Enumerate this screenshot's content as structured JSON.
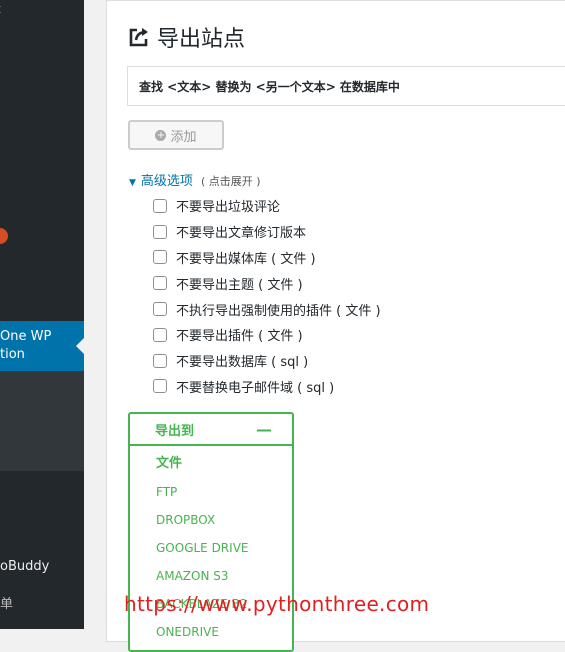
{
  "sidebar": {
    "top_fragment": "t",
    "badge": "",
    "active_item_line1": "One WP",
    "active_item_line2": "tion",
    "item_backupbuddy": "oBuddy",
    "item_menu": "单"
  },
  "panel": {
    "title": "导出站点",
    "title_icon": "export-icon",
    "search_replace_text": "查找 <文本> 替换为 <另一个文本> 在数据库中",
    "add_button_label": "添加",
    "advanced_label": "高级选项",
    "advanced_hint": "( 点击展开 )",
    "options": [
      "不要导出垃圾评论",
      "不要导出文章修订版本",
      "不要导出媒体库 ( 文件 )",
      "不要导出主题 ( 文件 )",
      "不执行导出强制使用的插件 ( 文件 )",
      "不要导出插件 ( 文件 )",
      "不要导出数据库 ( sql )",
      "不要替换电子邮件域 ( sql )"
    ],
    "export_to": {
      "label": "导出到",
      "destinations": [
        "文件",
        "FTP",
        "DROPBOX",
        "GOOGLE DRIVE",
        "AMAZON S3",
        "BACKBLAZE B2",
        "ONEDRIVE"
      ]
    }
  },
  "watermark": "https://www.pythonthree.com",
  "colors": {
    "accent": "#0073aa",
    "green": "#46b450",
    "sidebar": "#23282d",
    "watermark": "#e02020"
  }
}
